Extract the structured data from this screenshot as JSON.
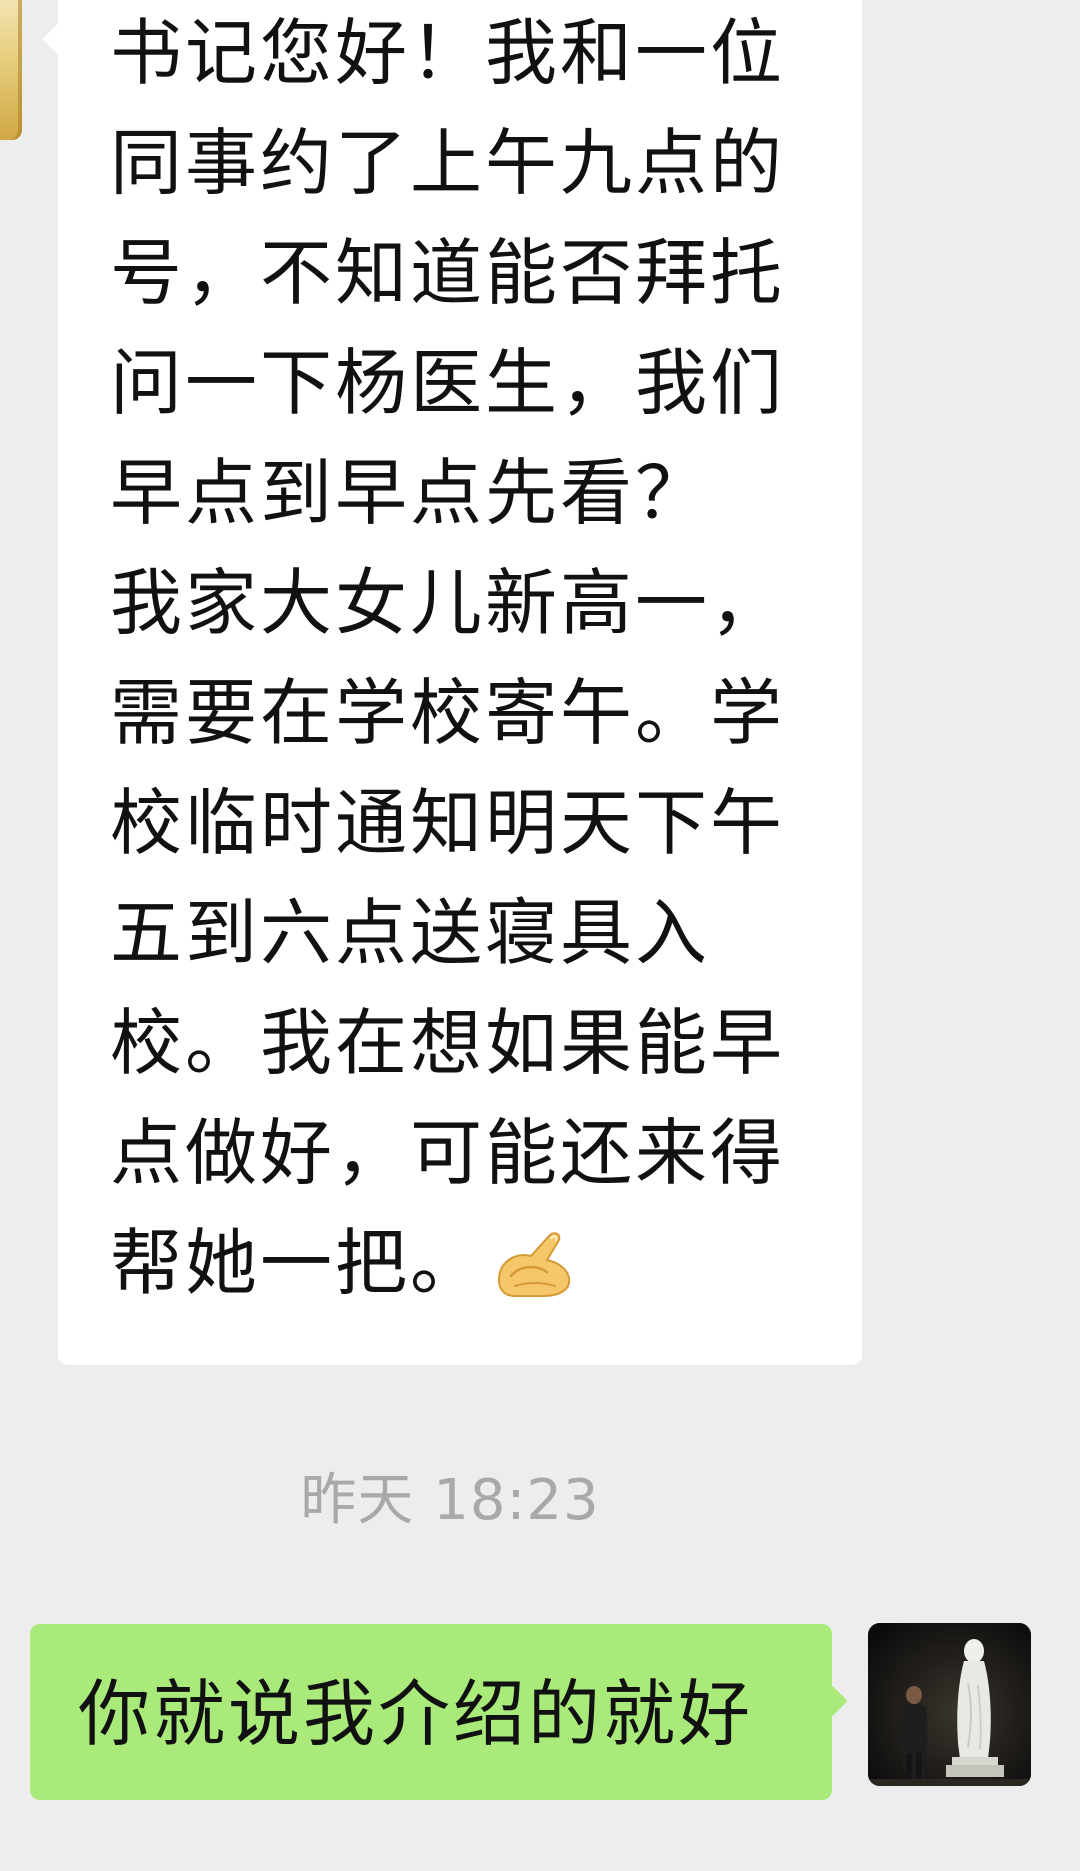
{
  "conversation": {
    "messages": [
      {
        "direction": "incoming",
        "text": "书记您好！我和一位同事约了上午九点的号，不知道能否拜托问一下杨医生，我们早点到早点先看？\n我家大女儿新高一，需要在学校寄午。学校临时通知明天下午五到六点送寝具入校。我在想如果能早点做好，可能还来得帮她一把。",
        "emoji": "pinching-hand-emoji"
      },
      {
        "direction": "outgoing",
        "text": "你就说我介绍的就好"
      }
    ],
    "timestamp": "昨天 18:23"
  },
  "colors": {
    "chat_background": "#ededed",
    "incoming_bubble": "#ffffff",
    "outgoing_bubble": "#a9ea7a",
    "timestamp_text": "#a9a9a9",
    "message_text": "#111111"
  }
}
